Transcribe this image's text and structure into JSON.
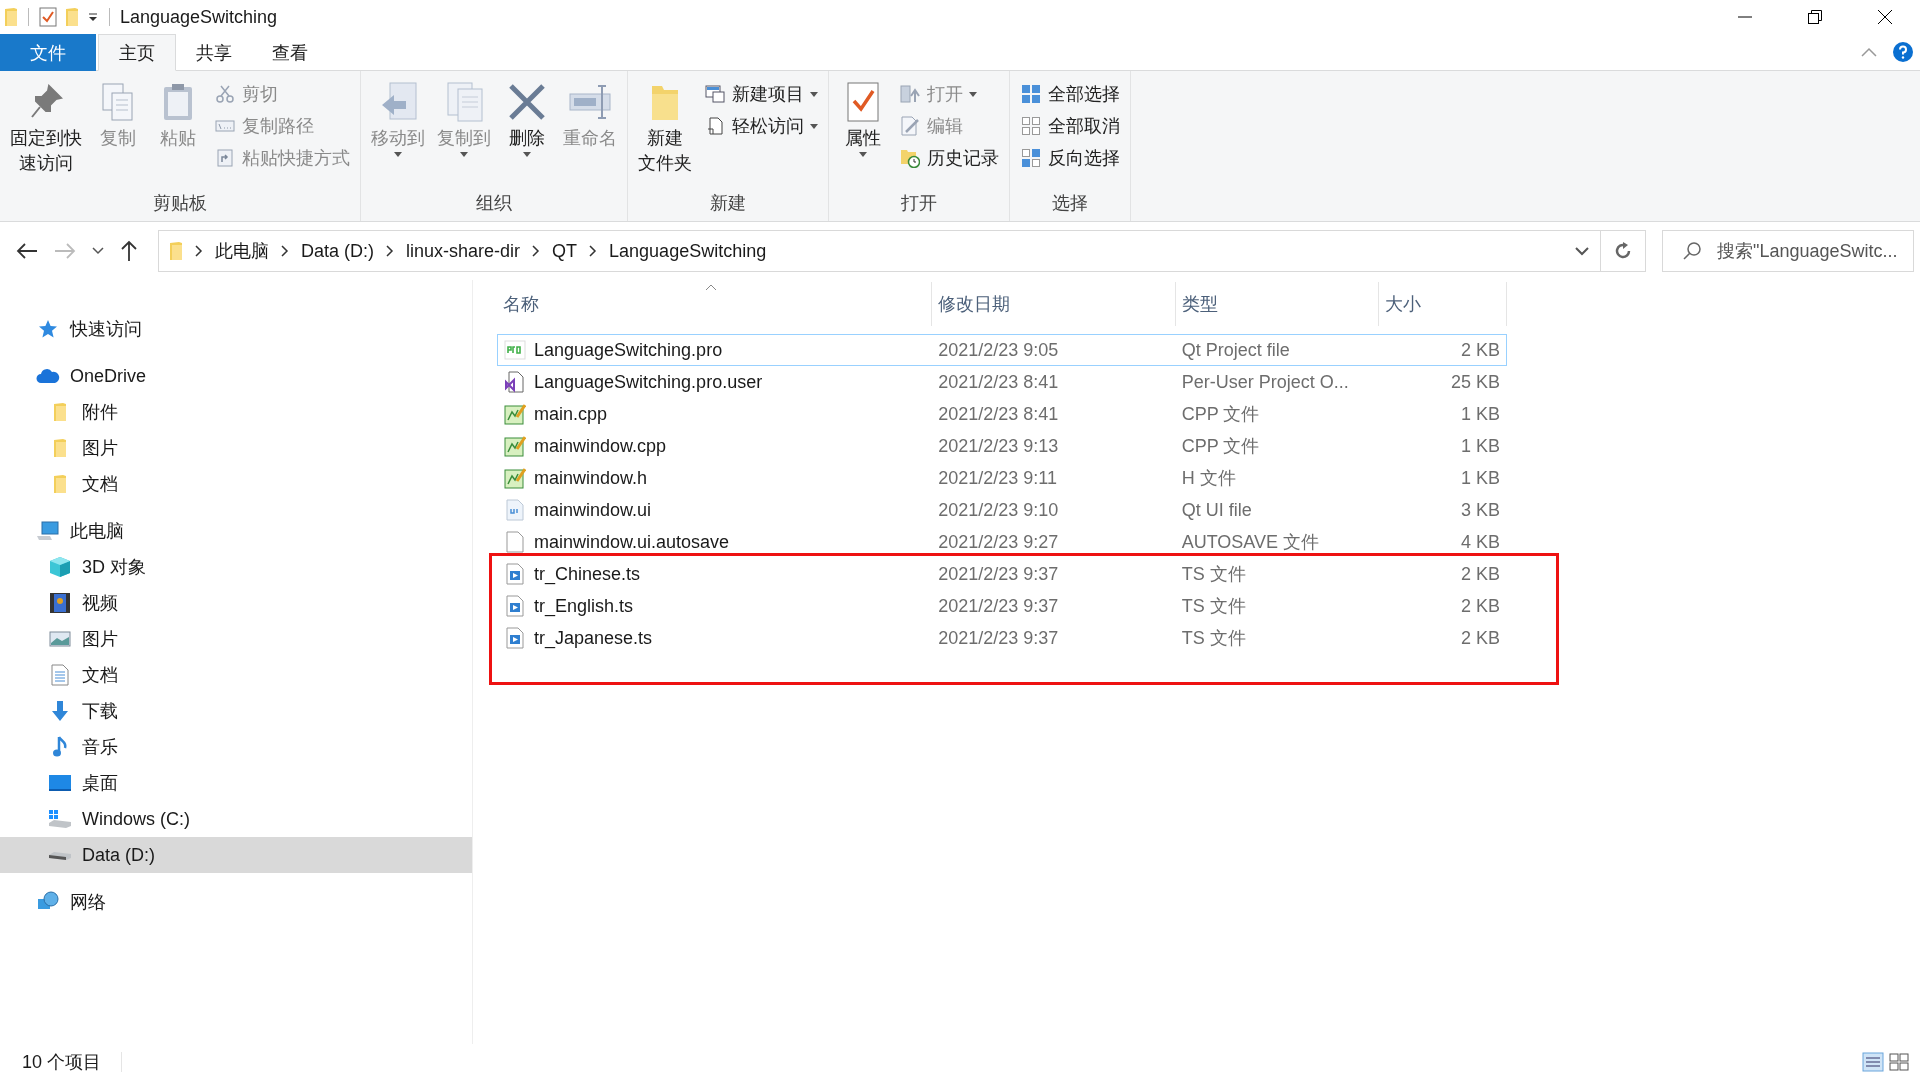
{
  "window": {
    "title": "LanguageSwitching"
  },
  "tabs": [
    {
      "label": "文件",
      "kind": "file",
      "selected": false
    },
    {
      "label": "主页",
      "kind": "tab",
      "selected": true
    },
    {
      "label": "共享",
      "kind": "tab",
      "selected": false
    },
    {
      "label": "查看",
      "kind": "tab",
      "selected": false
    }
  ],
  "ribbon": {
    "groups": [
      {
        "label": "剪贴板",
        "items": [
          {
            "kind": "large",
            "label_lines": [
              "固定到快",
              "速访问"
            ],
            "disabled": false,
            "dropdown": false
          },
          {
            "kind": "large",
            "label_lines": [
              "复制"
            ],
            "disabled": true,
            "dropdown": false
          },
          {
            "kind": "large",
            "label_lines": [
              "粘贴"
            ],
            "disabled": true,
            "dropdown": false
          },
          {
            "kind": "small",
            "label": "剪切",
            "disabled": true,
            "dropdown": false
          },
          {
            "kind": "small",
            "label": "复制路径",
            "disabled": true,
            "dropdown": false
          },
          {
            "kind": "small",
            "label": "粘贴快捷方式",
            "disabled": true,
            "dropdown": false
          }
        ]
      },
      {
        "label": "组织",
        "items": [
          {
            "kind": "large",
            "label_lines": [
              "移动到"
            ],
            "disabled": true,
            "dropdown": true
          },
          {
            "kind": "large",
            "label_lines": [
              "复制到"
            ],
            "disabled": true,
            "dropdown": true
          },
          {
            "kind": "large",
            "label_lines": [
              "删除"
            ],
            "disabled": false,
            "dropdown": true
          },
          {
            "kind": "large",
            "label_lines": [
              "重命名"
            ],
            "disabled": true,
            "dropdown": false
          }
        ]
      },
      {
        "label": "新建",
        "items": [
          {
            "kind": "large",
            "label_lines": [
              "新建",
              "文件夹"
            ],
            "disabled": false,
            "dropdown": false
          },
          {
            "kind": "small",
            "label": "新建项目",
            "disabled": false,
            "dropdown": true
          },
          {
            "kind": "small",
            "label": "轻松访问",
            "disabled": false,
            "dropdown": true
          }
        ]
      },
      {
        "label": "打开",
        "items": [
          {
            "kind": "large",
            "label_lines": [
              "属性"
            ],
            "disabled": false,
            "dropdown": true
          },
          {
            "kind": "small",
            "label": "打开",
            "disabled": true,
            "dropdown": true
          },
          {
            "kind": "small",
            "label": "编辑",
            "disabled": true,
            "dropdown": false
          },
          {
            "kind": "small",
            "label": "历史记录",
            "disabled": false,
            "dropdown": false
          }
        ]
      },
      {
        "label": "选择",
        "items": [
          {
            "kind": "small",
            "label": "全部选择",
            "disabled": false,
            "dropdown": false
          },
          {
            "kind": "small",
            "label": "全部取消",
            "disabled": false,
            "dropdown": false
          },
          {
            "kind": "small",
            "label": "反向选择",
            "disabled": false,
            "dropdown": false
          }
        ]
      }
    ]
  },
  "address_bar": {
    "path": [
      "此电脑",
      "Data (D:)",
      "linux-share-dir",
      "QT",
      "LanguageSwitching"
    ]
  },
  "search": {
    "placeholder": "搜索\"LanguageSwitc..."
  },
  "sidebar": {
    "items": [
      {
        "label": "快速访问",
        "selected": false
      },
      {
        "label": "OneDrive",
        "selected": false,
        "children": [
          {
            "label": "附件",
            "selected": false
          },
          {
            "label": "图片",
            "selected": false
          },
          {
            "label": "文档",
            "selected": false
          }
        ]
      },
      {
        "label": "此电脑",
        "selected": false,
        "children": [
          {
            "label": "3D 对象",
            "selected": false
          },
          {
            "label": "视频",
            "selected": false
          },
          {
            "label": "图片",
            "selected": false
          },
          {
            "label": "文档",
            "selected": false
          },
          {
            "label": "下载",
            "selected": false
          },
          {
            "label": "音乐",
            "selected": false
          },
          {
            "label": "桌面",
            "selected": false
          },
          {
            "label": "Windows (C:)",
            "selected": false
          },
          {
            "label": "Data (D:)",
            "selected": true
          }
        ]
      },
      {
        "label": "网络",
        "selected": false
      }
    ]
  },
  "table": {
    "columns": [
      {
        "label": "名称",
        "sorted": true
      },
      {
        "label": "修改日期",
        "sorted": false
      },
      {
        "label": "类型",
        "sorted": false
      },
      {
        "label": "大小",
        "sorted": false
      }
    ],
    "rows": [
      {
        "kind": "pro",
        "name": "LanguageSwitching.pro",
        "date": "2021/2/23 9:05",
        "type": "Qt Project file",
        "size": "2 KB",
        "focused": true,
        "highlighted": false
      },
      {
        "kind": "user",
        "name": "LanguageSwitching.pro.user",
        "date": "2021/2/23 8:41",
        "type": "Per-User Project O...",
        "size": "25 KB",
        "focused": false,
        "highlighted": false
      },
      {
        "kind": "cpp",
        "name": "main.cpp",
        "date": "2021/2/23 8:41",
        "type": "CPP 文件",
        "size": "1 KB",
        "focused": false,
        "highlighted": false
      },
      {
        "kind": "cpp",
        "name": "mainwindow.cpp",
        "date": "2021/2/23 9:13",
        "type": "CPP 文件",
        "size": "1 KB",
        "focused": false,
        "highlighted": false
      },
      {
        "kind": "cpp",
        "name": "mainwindow.h",
        "date": "2021/2/23 9:11",
        "type": "H 文件",
        "size": "1 KB",
        "focused": false,
        "highlighted": false
      },
      {
        "kind": "ui",
        "name": "mainwindow.ui",
        "date": "2021/2/23 9:10",
        "type": "Qt UI file",
        "size": "3 KB",
        "focused": false,
        "highlighted": false
      },
      {
        "kind": "plain",
        "name": "mainwindow.ui.autosave",
        "date": "2021/2/23 9:27",
        "type": "AUTOSAVE 文件",
        "size": "4 KB",
        "focused": false,
        "highlighted": false
      },
      {
        "kind": "ts",
        "name": "tr_Chinese.ts",
        "date": "2021/2/23 9:37",
        "type": "TS 文件",
        "size": "2 KB",
        "focused": false,
        "highlighted": true
      },
      {
        "kind": "ts",
        "name": "tr_English.ts",
        "date": "2021/2/23 9:37",
        "type": "TS 文件",
        "size": "2 KB",
        "focused": false,
        "highlighted": true
      },
      {
        "kind": "ts",
        "name": "tr_Japanese.ts",
        "date": "2021/2/23 9:37",
        "type": "TS 文件",
        "size": "2 KB",
        "focused": false,
        "highlighted": true
      }
    ]
  },
  "status_bar": {
    "item_count": "10 个项目"
  }
}
